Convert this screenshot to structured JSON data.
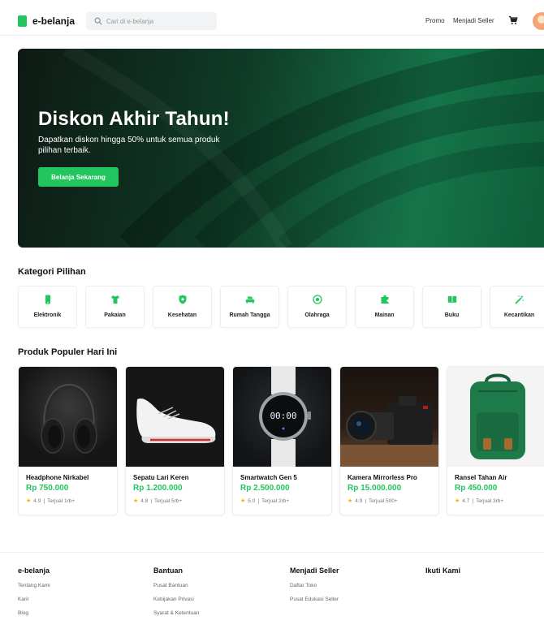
{
  "header": {
    "logo_text": "e-belanja",
    "search_placeholder": "Cari di e-belanja",
    "nav_promo": "Promo",
    "nav_seller": "Menjadi Seller"
  },
  "hero": {
    "title": "Diskon Akhir Tahun!",
    "subtitle": "Dapatkan diskon hingga 50% untuk semua produk pilihan terbaik.",
    "cta_label": "Belanja Sekarang"
  },
  "categories": {
    "title": "Kategori Pilihan",
    "items": [
      {
        "label": "Elektronik",
        "icon": "smartphone-icon"
      },
      {
        "label": "Pakaian",
        "icon": "shirt-icon"
      },
      {
        "label": "Kesehatan",
        "icon": "shield-icon"
      },
      {
        "label": "Rumah Tangga",
        "icon": "sofa-icon"
      },
      {
        "label": "Olahraga",
        "icon": "ball-icon"
      },
      {
        "label": "Mainan",
        "icon": "puzzle-icon"
      },
      {
        "label": "Buku",
        "icon": "book-icon"
      },
      {
        "label": "Kecantikan",
        "icon": "magic-wand-icon"
      }
    ]
  },
  "products": {
    "title": "Produk Populer Hari Ini",
    "items": [
      {
        "name": "Headphone Nirkabel",
        "price": "Rp 750.000",
        "rating": "4.9",
        "sold": "Terjual 1rb+"
      },
      {
        "name": "Sepatu Lari Keren",
        "price": "Rp 1.200.000",
        "rating": "4.8",
        "sold": "Terjual 5rb+"
      },
      {
        "name": "Smartwatch Gen 5",
        "price": "Rp 2.500.000",
        "rating": "5.0",
        "sold": "Terjual 2rb+",
        "watch_time": "00:00"
      },
      {
        "name": "Kamera Mirrorless Pro",
        "price": "Rp 15.000.000",
        "rating": "4.9",
        "sold": "Terjual 500+"
      },
      {
        "name": "Ransel Tahan Air",
        "price": "Rp 450.000",
        "rating": "4.7",
        "sold": "Terjual 3rb+"
      }
    ]
  },
  "footer": {
    "columns": [
      {
        "title": "e-belanja",
        "links": [
          "Tentang Kami",
          "Karir",
          "Blog"
        ]
      },
      {
        "title": "Bantuan",
        "links": [
          "Pusat Bantuan",
          "Kebijakan Privasi",
          "Syarat & Ketentuan"
        ]
      },
      {
        "title": "Menjadi Seller",
        "links": [
          "Daftar Toko",
          "Pusat Edukasi Seller"
        ]
      },
      {
        "title": "Ikuti Kami",
        "links": []
      }
    ]
  },
  "colors": {
    "accent": "#22c55e",
    "hero_dark": "#0e1a14",
    "star": "#f5b301"
  }
}
